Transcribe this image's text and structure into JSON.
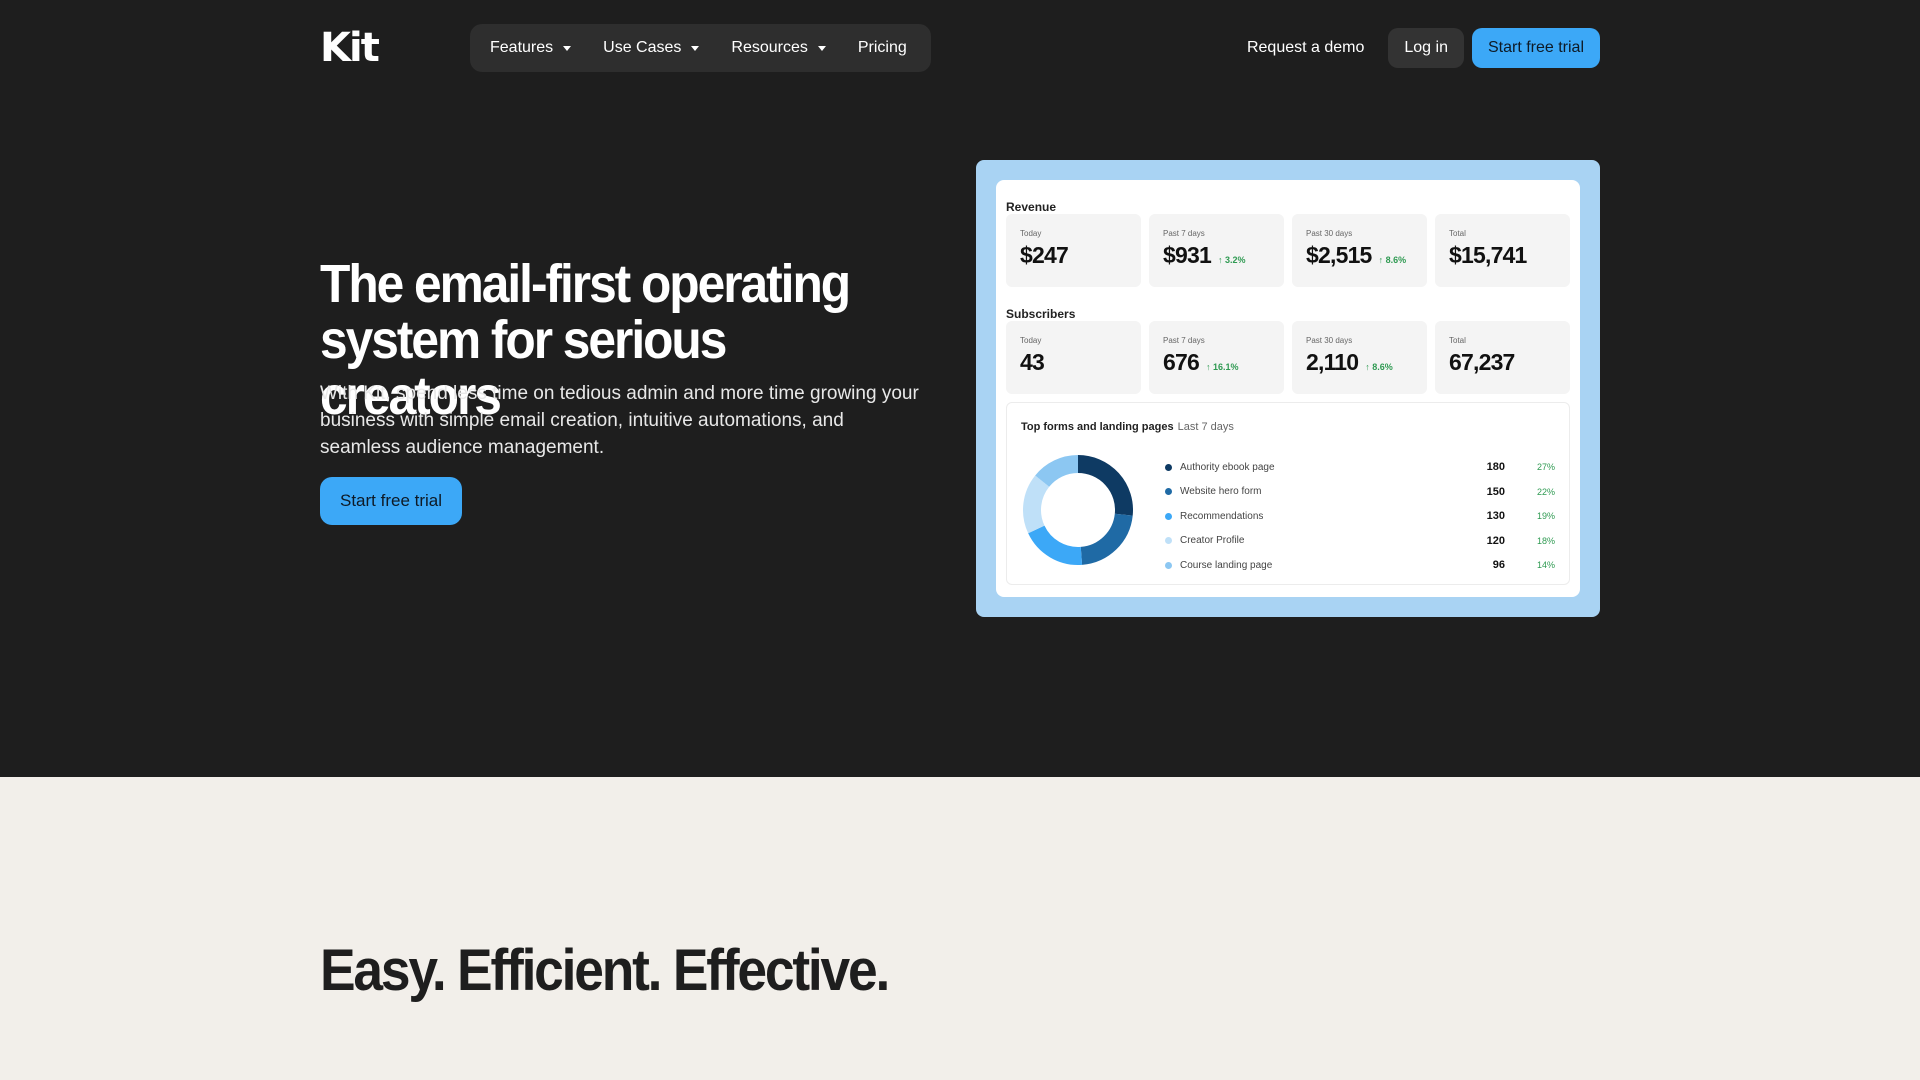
{
  "nav": {
    "logo": "Kit",
    "menu": [
      {
        "label": "Features",
        "dropdown": true
      },
      {
        "label": "Use Cases",
        "dropdown": true
      },
      {
        "label": "Resources",
        "dropdown": true
      },
      {
        "label": "Pricing",
        "dropdown": false
      }
    ],
    "request_demo": "Request a demo",
    "login": "Log in",
    "start_trial": "Start free trial"
  },
  "hero": {
    "title_line1": "The email-first operating",
    "title_line2": "system for serious creators",
    "subtitle": "With Kit, spend less time on tedious admin and more time growing your business with simple email creation, intuitive automations, and seamless audience management.",
    "cta": "Start free trial"
  },
  "dashboard": {
    "revenue": {
      "label": "Revenue",
      "stats": [
        {
          "period": "Today",
          "value": "$247",
          "delta": ""
        },
        {
          "period": "Past 7 days",
          "value": "$931",
          "delta": "↑ 3.2%"
        },
        {
          "period": "Past 30 days",
          "value": "$2,515",
          "delta": "↑ 8.6%"
        },
        {
          "period": "Total",
          "value": "$15,741",
          "delta": ""
        }
      ]
    },
    "subscribers": {
      "label": "Subscribers",
      "stats": [
        {
          "period": "Today",
          "value": "43",
          "delta": ""
        },
        {
          "period": "Past 7 days",
          "value": "676",
          "delta": "↑ 16.1%"
        },
        {
          "period": "Past 30 days",
          "value": "2,110",
          "delta": "↑ 8.6%"
        },
        {
          "period": "Total",
          "value": "67,237",
          "delta": ""
        }
      ]
    },
    "forms": {
      "title": "Top forms and landing pages",
      "period": "Last 7 days",
      "items": [
        {
          "name": "Authority ebook page",
          "count": "180",
          "pct": "27%",
          "color": "#0e3a63"
        },
        {
          "name": "Website hero form",
          "count": "150",
          "pct": "22%",
          "color": "#1f6aa5"
        },
        {
          "name": "Recommendations",
          "count": "130",
          "pct": "19%",
          "color": "#3ca8f7"
        },
        {
          "name": "Creator Profile",
          "count": "120",
          "pct": "18%",
          "color": "#bfe0f8"
        },
        {
          "name": "Course landing page",
          "count": "96",
          "pct": "14%",
          "color": "#8cc7f2"
        }
      ]
    }
  },
  "lower": {
    "title": "Easy. Efficient. Effective."
  }
}
